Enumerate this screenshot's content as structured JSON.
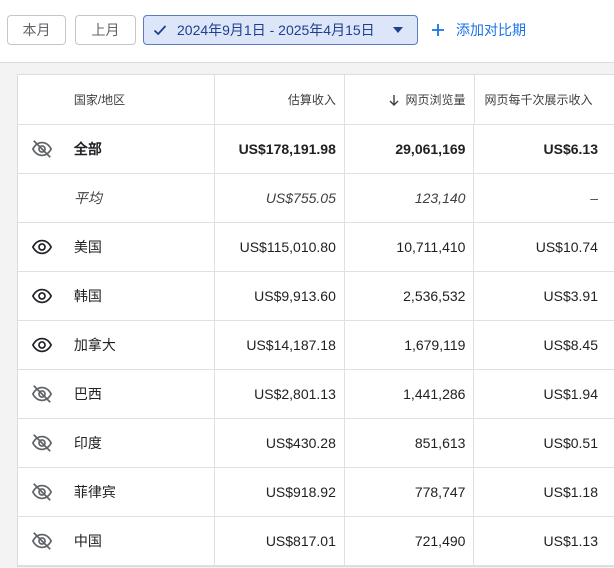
{
  "toolbar": {
    "this_month": "本月",
    "last_month": "上月",
    "date_range": "2024年9月1日 - 2025年4月15日",
    "add_compare": "添加对比期"
  },
  "table": {
    "headers": {
      "country": "国家/地区",
      "revenue": "估算收入",
      "pageviews": "网页浏览量",
      "rpm": "网页每千次展示收入"
    },
    "total": {
      "country": "全部",
      "revenue": "US$178,191.98",
      "pageviews": "29,061,169",
      "rpm": "US$6.13",
      "icon": "eye-off-icon"
    },
    "average": {
      "country": "平均",
      "revenue": "US$755.05",
      "pageviews": "123,140",
      "rpm": "–"
    },
    "rows": [
      {
        "country": "美国",
        "revenue": "US$115,010.80",
        "pageviews": "10,711,410",
        "rpm": "US$10.74",
        "icon": "eye-icon"
      },
      {
        "country": "韩国",
        "revenue": "US$9,913.60",
        "pageviews": "2,536,532",
        "rpm": "US$3.91",
        "icon": "eye-icon"
      },
      {
        "country": "加拿大",
        "revenue": "US$14,187.18",
        "pageviews": "1,679,119",
        "rpm": "US$8.45",
        "icon": "eye-icon"
      },
      {
        "country": "巴西",
        "revenue": "US$2,801.13",
        "pageviews": "1,441,286",
        "rpm": "US$1.94",
        "icon": "eye-off-icon"
      },
      {
        "country": "印度",
        "revenue": "US$430.28",
        "pageviews": "851,613",
        "rpm": "US$0.51",
        "icon": "eye-off-icon"
      },
      {
        "country": "菲律宾",
        "revenue": "US$918.92",
        "pageviews": "778,747",
        "rpm": "US$1.18",
        "icon": "eye-off-icon"
      },
      {
        "country": "中国",
        "revenue": "US$817.01",
        "pageviews": "721,490",
        "rpm": "US$1.13",
        "icon": "eye-off-icon"
      }
    ]
  }
}
